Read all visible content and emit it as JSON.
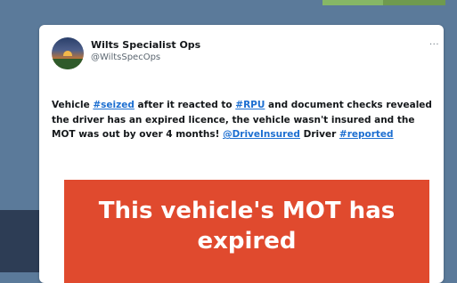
{
  "tweet": {
    "display_name": "Wilts Specialist Ops",
    "handle": "@WiltsSpecOps",
    "more_icon": "more-horizontal-icon",
    "text": {
      "part1": "Vehicle ",
      "hashtag_seized": "#seized",
      "part2": " after it reacted to ",
      "hashtag_rpu": "#RPU",
      "part3": " and document checks revealed the driver has an expired licence, the vehicle wasn't insured and the MOT was out by over 4 months! ",
      "mention": "@DriveInsured",
      "part4": " Driver ",
      "hashtag_reported": "#reported"
    },
    "media": {
      "caption": "This vehicle's MOT has\nexpired",
      "background_color": "#e04a2e"
    }
  },
  "colors": {
    "page_background": "#5b7a9a",
    "link": "#1d6fd1",
    "accent": "#86b766"
  }
}
